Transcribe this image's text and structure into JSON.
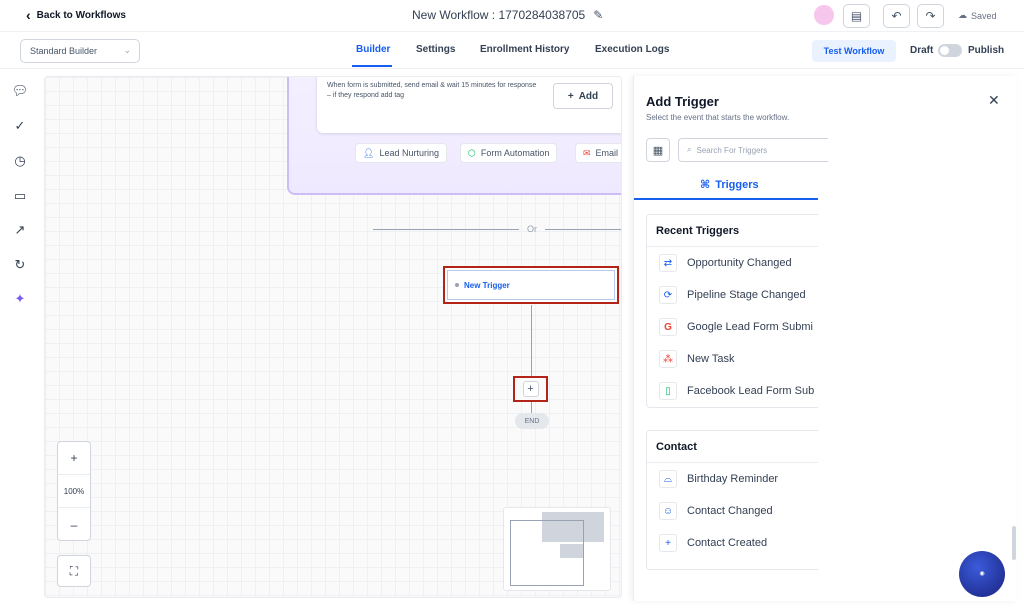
{
  "header": {
    "back_label": "Back to Workflows",
    "workflow_title": "New Workflow : 1770284038705",
    "saved_label": "Saved"
  },
  "subbar": {
    "builder_select_value": "Standard Builder",
    "tabs": [
      {
        "label": "Builder",
        "active": true
      },
      {
        "label": "Settings",
        "active": false
      },
      {
        "label": "Enrollment History",
        "active": false
      },
      {
        "label": "Execution Logs",
        "active": false
      }
    ],
    "test_workflow_label": "Test Workflow",
    "draft_label": "Draft",
    "publish_label": "Publish",
    "publish_enabled": false
  },
  "canvas": {
    "template_desc": "When form is submitted, send email & wait 15 minutes for response – if they respond add tag",
    "template_desc_tail": "they respond add tag",
    "add_label": "Add",
    "chips": [
      "Lead Nurturing",
      "Form Automation",
      "Email"
    ],
    "or_label": "Or",
    "trigger_label": "New Trigger",
    "plus_label": "+",
    "end_label": "END",
    "zoom_in": "+",
    "zoom_level": "100%",
    "zoom_out": "–"
  },
  "panel": {
    "title": "Add Trigger",
    "subtitle": "Select the event that starts the workflow.",
    "search_placeholder": "Search For Triggers",
    "tab_label": "Triggers",
    "recent_title": "Recent Triggers",
    "recent_items": [
      {
        "label": "Opportunity Changed",
        "icon": "swap-arrows-icon"
      },
      {
        "label": "Pipeline Stage Changed",
        "icon": "refresh-icon"
      },
      {
        "label": "Google Lead Form Submi",
        "icon": "google-icon"
      },
      {
        "label": "New Task",
        "icon": "task-icon"
      },
      {
        "label": "Facebook Lead Form Sub",
        "icon": "clipboard-icon"
      }
    ],
    "contact_title": "Contact",
    "contact_items": [
      {
        "label": "Birthday Reminder",
        "icon": "cake-icon"
      },
      {
        "label": "Contact Changed",
        "icon": "contact-icon"
      },
      {
        "label": "Contact Created",
        "icon": "contact-add-icon"
      }
    ]
  },
  "colors": {
    "accent": "#155eef",
    "highlight_border": "#b42318",
    "template_border": "#cdbdf7"
  }
}
